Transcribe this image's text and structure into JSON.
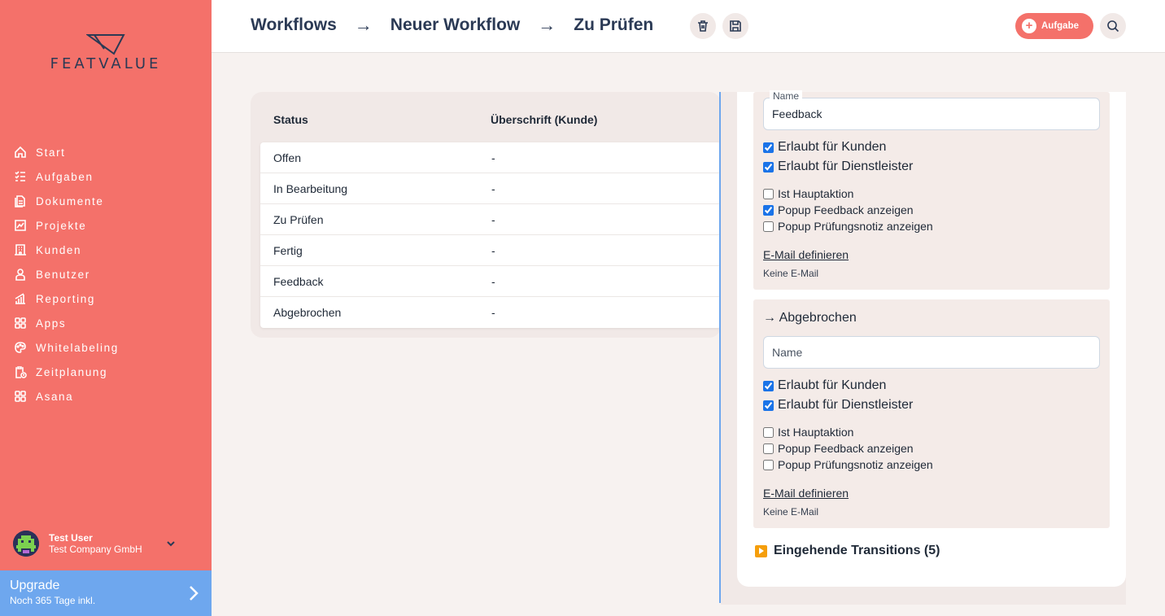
{
  "brand": {
    "name": "FEATVALUE"
  },
  "sidebar": {
    "items": [
      {
        "label": "Start",
        "icon": "home-icon"
      },
      {
        "label": "Aufgaben",
        "icon": "tasks-icon"
      },
      {
        "label": "Dokumente",
        "icon": "documents-icon"
      },
      {
        "label": "Projekte",
        "icon": "projects-icon"
      },
      {
        "label": "Kunden",
        "icon": "building-icon"
      },
      {
        "label": "Benutzer",
        "icon": "user-icon"
      },
      {
        "label": "Reporting",
        "icon": "chart-icon"
      },
      {
        "label": "Apps",
        "icon": "apps-icon"
      },
      {
        "label": "Whitelabeling",
        "icon": "palette-icon"
      },
      {
        "label": "Zeitplanung",
        "icon": "clipboard-clock-icon"
      },
      {
        "label": "Asana",
        "icon": "apps-icon"
      }
    ],
    "user": {
      "name": "Test User",
      "company": "Test Company GmbH"
    },
    "upgrade": {
      "title": "Upgrade",
      "subtitle": "Noch 365 Tage inkl."
    }
  },
  "header": {
    "breadcrumbs": [
      "Workflows",
      "Neuer Workflow",
      "Zu Prüfen"
    ],
    "separator": "→",
    "task_button": "Aufgabe"
  },
  "table": {
    "columns": [
      "Status",
      "Überschrift (Kunde)"
    ],
    "rows": [
      [
        "Offen",
        "-"
      ],
      [
        "In Bearbeitung",
        "-"
      ],
      [
        "Zu Prüfen",
        "-"
      ],
      [
        "Fertig",
        "-"
      ],
      [
        "Feedback",
        "-"
      ],
      [
        "Abgebrochen",
        "-"
      ]
    ]
  },
  "panel": {
    "feedback_box": {
      "name_label": "Name",
      "name_value": "Feedback",
      "allowed_customers": "Erlaubt für Kunden",
      "allowed_providers": "Erlaubt für Dienstleister",
      "main_action": "Ist Hauptaktion",
      "popup_feedback": "Popup Feedback anzeigen",
      "popup_review": "Popup Prüfungsnotiz anzeigen",
      "email_link": "E-Mail definieren",
      "email_status": "Keine E-Mail"
    },
    "cancelled_box": {
      "title": "→ Abgebrochen",
      "name_placeholder": "Name",
      "allowed_customers": "Erlaubt für Kunden",
      "allowed_providers": "Erlaubt für Dienstleister",
      "main_action": "Ist Hauptaktion",
      "popup_feedback": "Popup Feedback anzeigen",
      "popup_review": "Popup Prüfungsnotiz anzeigen",
      "email_link": "E-Mail definieren",
      "email_status": "Keine E-Mail"
    },
    "incoming": "Eingehende Transitions (5)"
  },
  "colors": {
    "brand": "#f4716a",
    "accent": "#6ea7ee",
    "text": "#2b3a55"
  }
}
